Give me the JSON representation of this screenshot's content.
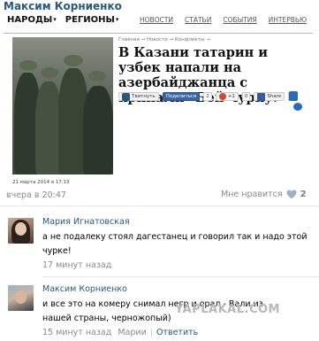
{
  "post": {
    "author": "Максим Корниенко",
    "time": "вчера в 20:47",
    "like_label": "Мне нравится",
    "like_count": "2"
  },
  "news_site": {
    "nav_left": [
      "НАРОДЫ",
      "РЕГИОНЫ"
    ],
    "nav_right": [
      "НОВОСТИ",
      "СТАТЬИ",
      "СОБЫТИЯ",
      "ИНТЕРВЬЮ"
    ],
    "breadcrumb": "Главная → Новости → Конфликты →",
    "title": "В Казани татарин и узбек напали на азербайджанца с криками \"Бей чурку!\"",
    "share": {
      "vk_label": "Твитнуть",
      "share_label": "Поделиться",
      "share_count": "2",
      "gplus_label": "+1",
      "gplus_count": "0",
      "fb_label": "Share",
      "fb_count": "6"
    },
    "date": "21 марта 2014 в 17:19"
  },
  "comments": [
    {
      "author": "Мария Игнатовская",
      "text": "а не подалеку стоял дагестанец и говорил так и надо этой чурке!",
      "time": "17 минут назад"
    },
    {
      "author": "Максим Корниенко",
      "text": "и все это на комеру снимал негр и орал - Вали из нашей страны, черножопый)",
      "time": "15 минут назад",
      "reply_to": "Марии",
      "reply_label": "Ответить"
    }
  ],
  "watermark": "YAPLAKAL.COM",
  "colors": {
    "link": "#2b587a",
    "muted": "#8a8a8a",
    "share_dark": "#3a64a0"
  },
  "icons": [
    "heart-icon",
    "dropdown-icon",
    "vk-icon",
    "gplus-icon",
    "facebook-icon"
  ]
}
